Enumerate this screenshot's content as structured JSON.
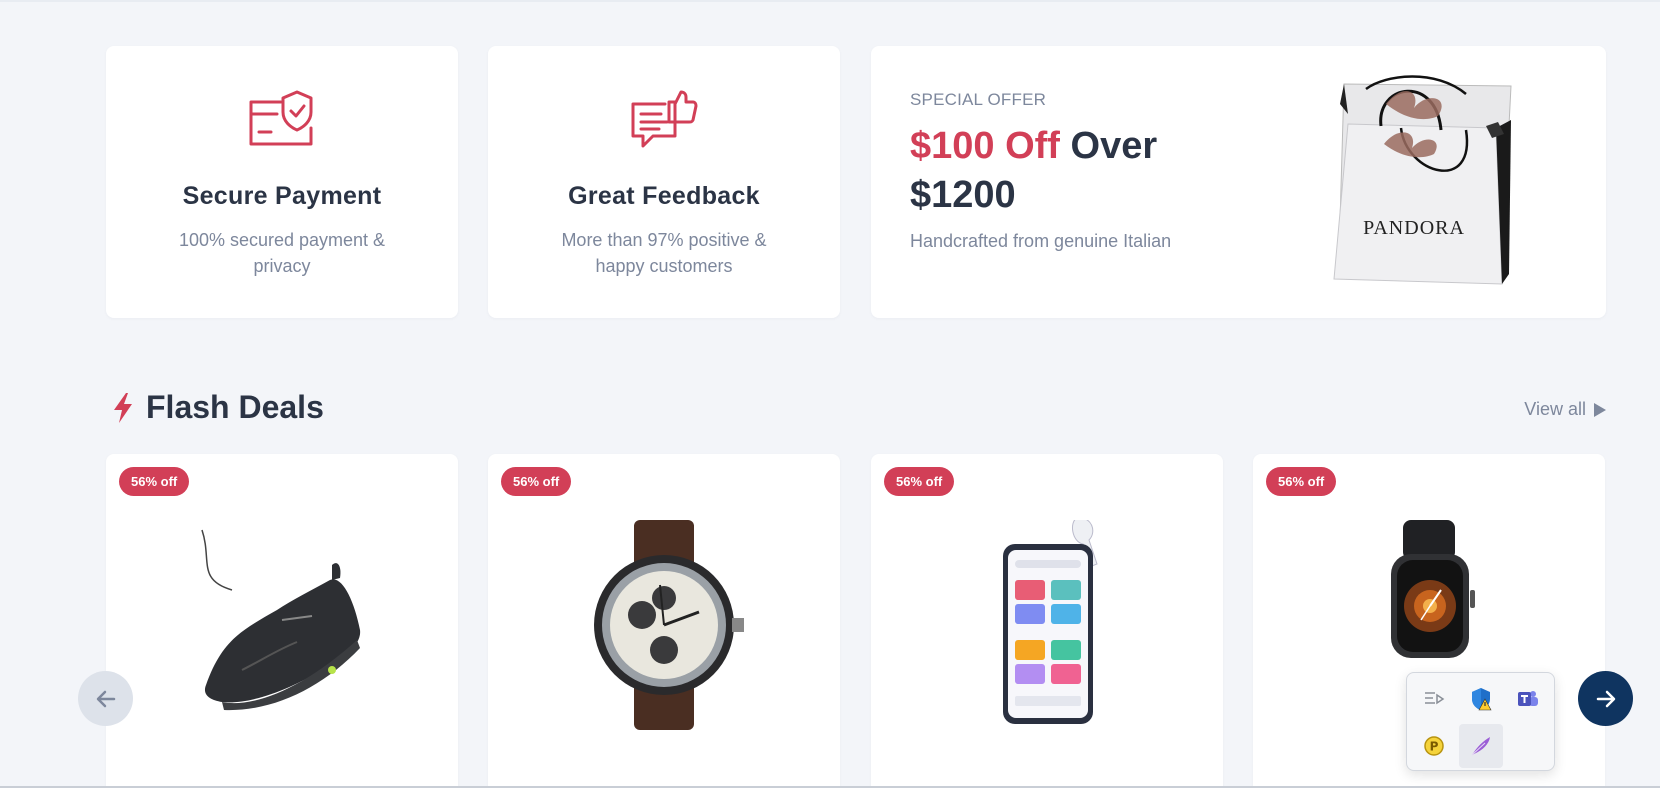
{
  "features": [
    {
      "title": "Secure Payment",
      "desc": "100% secured payment & privacy",
      "icon": "secure-payment-icon"
    },
    {
      "title": "Great Feedback",
      "desc": "More than 97% positive & happy customers",
      "icon": "feedback-icon"
    }
  ],
  "offer": {
    "kicker": "SPECIAL OFFER",
    "headline_accent": "$100 Off",
    "headline_rest": " Over $1200",
    "sub": "Handcrafted from genuine Italian",
    "bag_text": "PANDORA"
  },
  "flash": {
    "title": "Flash Deals",
    "view_all": "View all",
    "products": [
      {
        "badge": "56% off",
        "image": "sneaker-image"
      },
      {
        "badge": "56% off",
        "image": "watch-image"
      },
      {
        "badge": "56% off",
        "image": "phone-image"
      },
      {
        "badge": "56% off",
        "image": "smartwatch-image"
      }
    ]
  },
  "tray": {
    "icons": [
      "system-tray-queue-icon",
      "defender-warning-icon",
      "teams-icon",
      "p-coin-icon",
      "pen-feather-icon"
    ]
  },
  "colors": {
    "accent": "#d23f57",
    "navy": "#0f3460",
    "text": "#2b3445",
    "muted": "#7d879c"
  }
}
